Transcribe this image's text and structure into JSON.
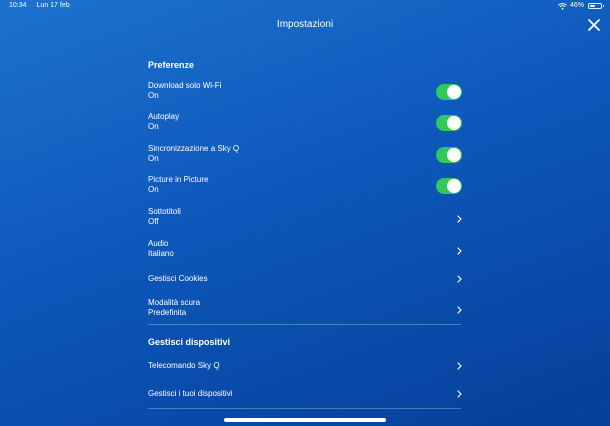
{
  "status_bar": {
    "time": "10:34",
    "date": "Lun 17 feb",
    "battery_percent": "46%",
    "battery_level": 0.46
  },
  "header": {
    "title": "Impostazioni",
    "close_icon": "close-icon"
  },
  "sections": {
    "preferences": {
      "title": "Preferenze",
      "items": [
        {
          "label": "Download solo Wi-Fi",
          "value": "On",
          "control": "toggle"
        },
        {
          "label": "Autoplay",
          "value": "On",
          "control": "toggle"
        },
        {
          "label": "Sincronizzazione a Sky Q",
          "value": "On",
          "control": "toggle"
        },
        {
          "label": "Picture in Picture",
          "value": "On",
          "control": "toggle"
        },
        {
          "label": "Sottotitoli",
          "value": "Off",
          "control": "chevron"
        },
        {
          "label": "Audio",
          "value": "Italiano",
          "control": "chevron"
        },
        {
          "label": "Gestisci Cookies",
          "control": "chevron"
        },
        {
          "label": "Modalità scura",
          "value": "Predefinita",
          "control": "chevron"
        }
      ]
    },
    "devices": {
      "title": "Gestisci dispositivi",
      "items": [
        {
          "label": "Telecomando Sky Q",
          "control": "chevron"
        },
        {
          "label": "Gestisci i tuoi dispositivi",
          "control": "chevron"
        }
      ]
    }
  },
  "colors": {
    "background_top": "#1d72cf",
    "background_bottom": "#053f98",
    "toggle_on": "#34c759",
    "text": "#ffffff"
  }
}
